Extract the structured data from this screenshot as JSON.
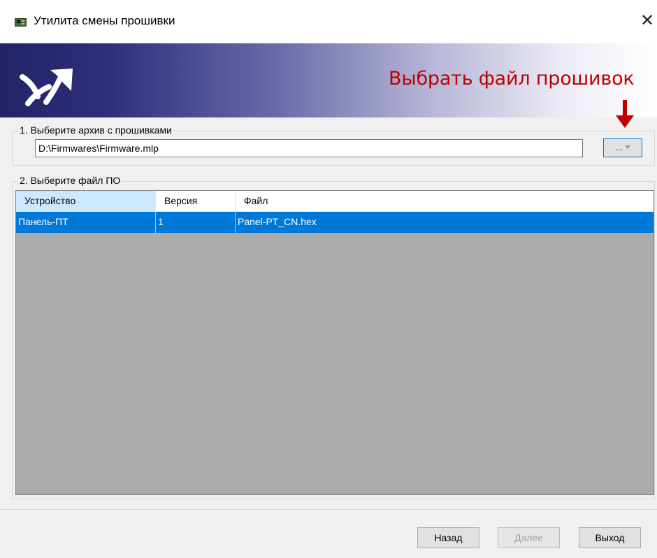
{
  "window": {
    "title": "Утилита смены прошивки",
    "close_glyph": "✕",
    "icon": "circuit-board-icon"
  },
  "banner": {
    "logo": "arrow-logo-icon",
    "annotation": "Выбрать файл прошивок",
    "annotation_color": "#c00000"
  },
  "archive_group": {
    "legend": "1. Выберите архив с прошивками",
    "path_value": "D:\\Firmwares\\Firmware.mlp",
    "browse_label": "..."
  },
  "firmware_group": {
    "legend": "2. Выберите файл ПО",
    "columns": [
      "Устройство",
      "Версия",
      "Файл"
    ],
    "rows": [
      {
        "device": "Панель-ПТ",
        "version": "1",
        "file": "Panel-PT_CN.hex",
        "selected": true
      }
    ]
  },
  "buttons": {
    "back": "Назад",
    "next": "Далее",
    "exit": "Выход"
  },
  "colors": {
    "selection": "#0078d7",
    "header_sorted": "#cce8ff"
  }
}
